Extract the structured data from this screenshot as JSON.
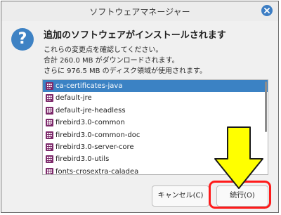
{
  "window": {
    "title": "ソフトウェアマネージャー"
  },
  "dialog": {
    "heading": "追加のソフトウェアがインストールされます",
    "lines": [
      "これらの変更点を確認してください。",
      "合計 260.0 MB がダウンロードされます。",
      "さらに 976.5 MB のディスク領域が使用されます。"
    ]
  },
  "packages": [
    "ca-certificates-java",
    "default-jre",
    "default-jre-headless",
    "firebird3.0-common",
    "firebird3.0-common-doc",
    "firebird3.0-server-core",
    "firebird3.0-utils",
    "fonts-crosextra-caladea"
  ],
  "buttons": {
    "cancel": "キャンセル(C)",
    "continue": "続行(O)"
  },
  "colors": {
    "accent": "#3b82c4",
    "annotation_arrow": "#ffff00",
    "annotation_box": "#ff1a1a"
  },
  "icons": {
    "close": "close-icon",
    "question": "question-icon",
    "package": "package-icon"
  }
}
